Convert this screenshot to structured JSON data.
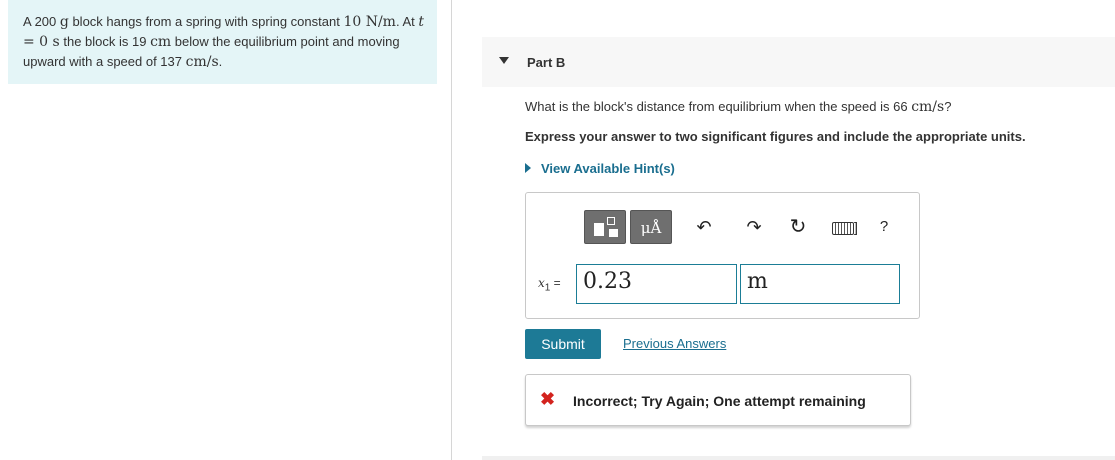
{
  "problem": {
    "text_1": "A 200 ",
    "mass_unit": "g",
    "text_2": " block hangs from a spring with spring constant ",
    "k_value": "10 ",
    "k_unit": "N/m",
    "text_3": ". At ",
    "t_var": "t",
    "t_eq": " = 0 ",
    "t_unit": "s",
    "text_4": " the block is 19 ",
    "dist_unit": "cm",
    "text_5": " below the equilibrium point and moving upward with a speed of 137 ",
    "speed_unit": "cm/s",
    "text_6": "."
  },
  "part": {
    "title": "Part B"
  },
  "question": {
    "text": "What is the block's distance from equilibrium when the speed is 66 ",
    "unit": "cm/s",
    "suffix": "?"
  },
  "instruction": "Express your answer to two significant figures and include the appropriate units.",
  "hint_label": "View Available Hint(s)",
  "toolbar": {
    "units_label": "μÅ",
    "undo_icon": "↶",
    "redo_icon": "↷",
    "reset_icon": "↻",
    "keyboard_suffix": "]",
    "help_label": "?"
  },
  "answer": {
    "var_name": "x",
    "var_sub": "1",
    "equals": " =",
    "value": "0.23",
    "unit": "m"
  },
  "submit_label": "Submit",
  "previous_answers_label": "Previous Answers",
  "feedback": {
    "icon": "✖",
    "text": "Incorrect; Try Again; One attempt remaining"
  },
  "colors": {
    "accent": "#1d7a96",
    "error": "#d3231e",
    "problem_bg": "#e4f5f7"
  }
}
